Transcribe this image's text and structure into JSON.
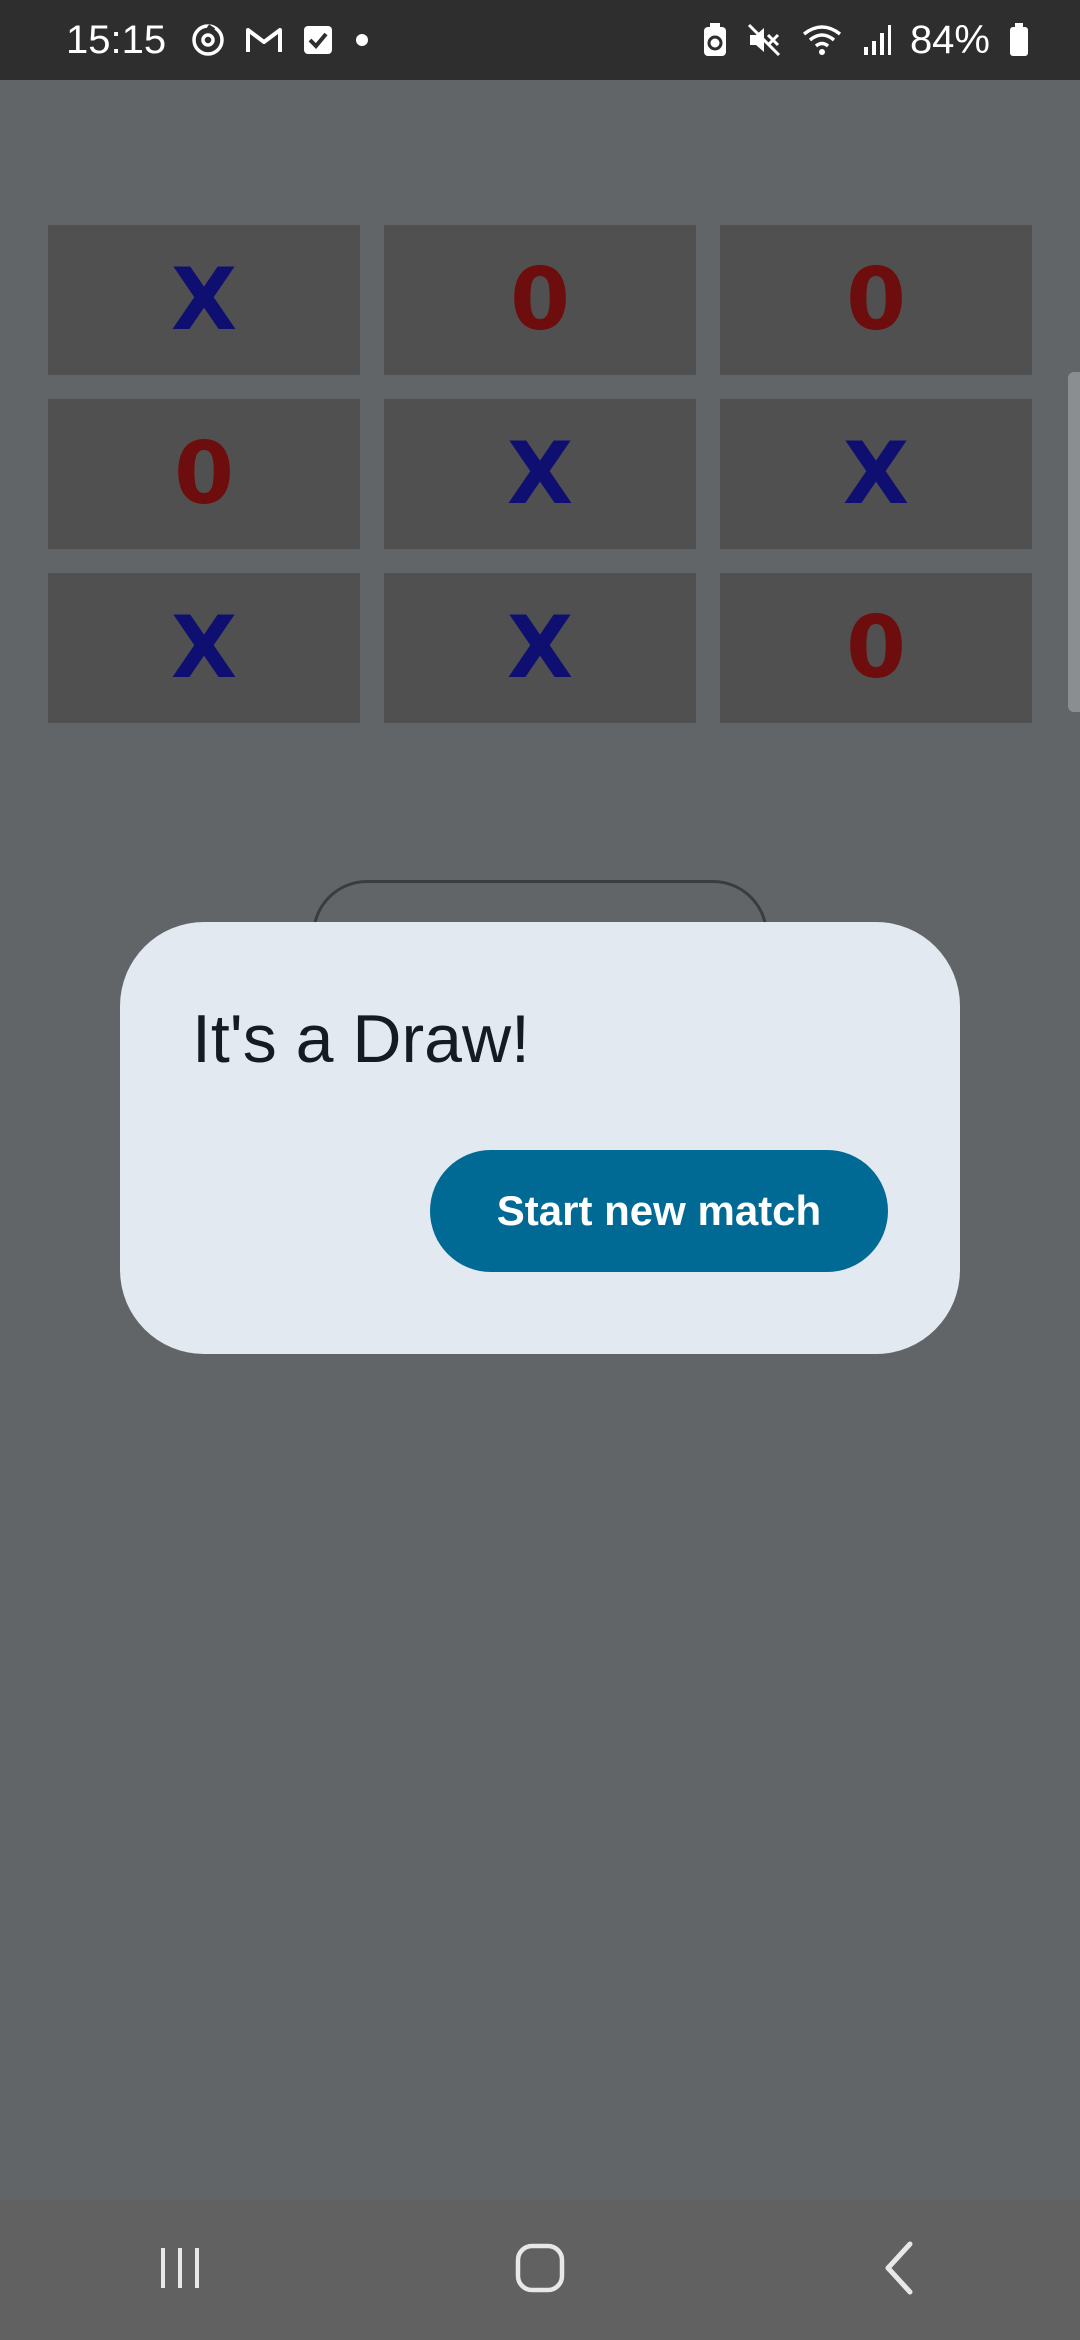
{
  "status_bar": {
    "time": "15:15",
    "battery_percent": "84%",
    "icons_left": [
      "sync-icon",
      "gmail-icon",
      "checkbox-icon",
      "dot-icon"
    ],
    "icons_right": [
      "battery-saver-icon",
      "mute-icon",
      "wifi-icon",
      "signal-icon",
      "battery-icon"
    ]
  },
  "board": {
    "cells": [
      "X",
      "0",
      "0",
      "0",
      "X",
      "X",
      "X",
      "X",
      "0"
    ],
    "colors": {
      "X": "#0f0f72",
      "O": "#6e0d0d",
      "cell_bg": "#505050"
    }
  },
  "dialog": {
    "title": "It's a Draw!",
    "button_label": "Start new match",
    "accent_color": "#006a94"
  },
  "nav_bar": {
    "buttons": [
      "recent-apps-icon",
      "home-icon",
      "back-icon"
    ]
  }
}
